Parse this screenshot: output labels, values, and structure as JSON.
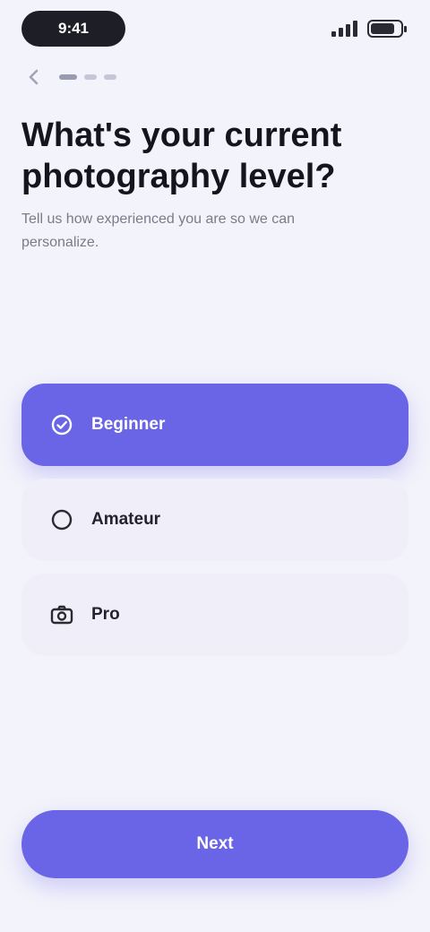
{
  "status_bar": {
    "time": "9:41"
  },
  "title": "What's your current photography level?",
  "subtitle": "Tell us how experienced you are so we can personalize.",
  "options": [
    {
      "label": "Beginner",
      "icon": "check-circle-icon",
      "selected": true
    },
    {
      "label": "Amateur",
      "icon": "circle-icon",
      "selected": false
    },
    {
      "label": "Pro",
      "icon": "camera-icon",
      "selected": false
    }
  ],
  "continue_label": "Next",
  "colors": {
    "accent": "#6a64e6",
    "background": "#f3f3fb",
    "option_bg": "#f0eff9"
  }
}
